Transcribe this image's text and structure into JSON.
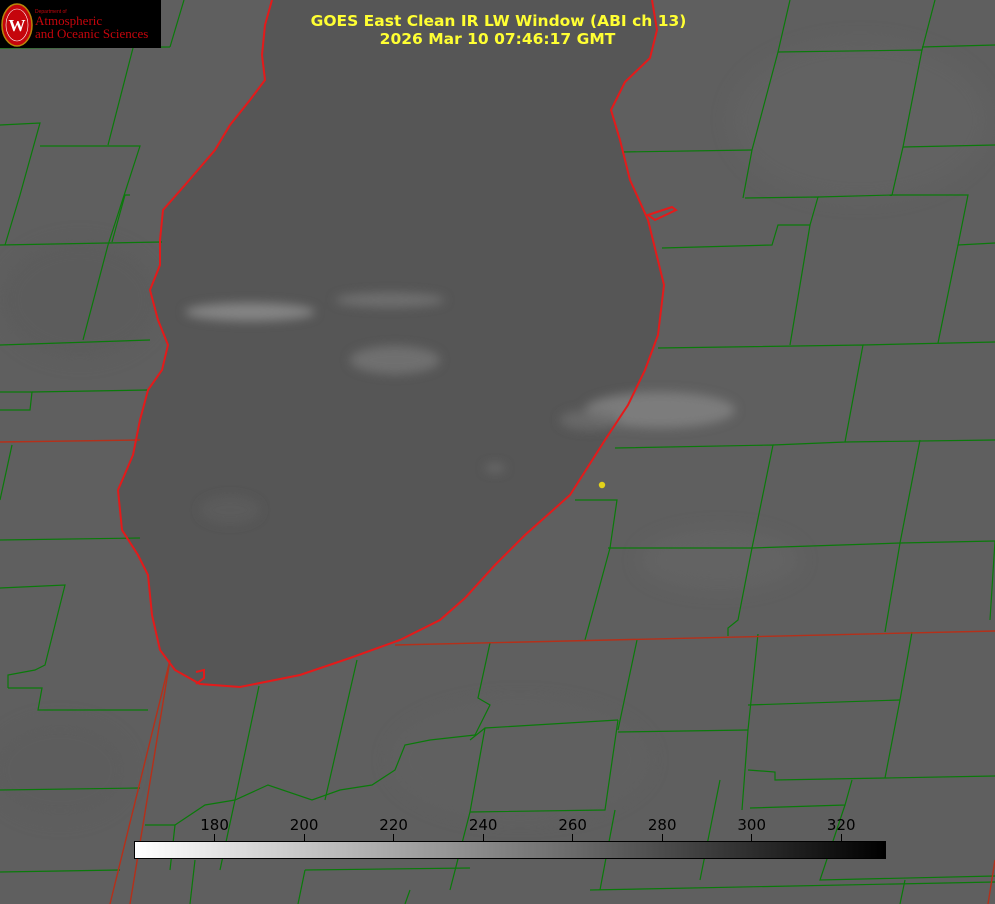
{
  "header": {
    "title_line1": "GOES East Clean IR LW Window (ABI ch 13)",
    "title_line2": "2026 Mar 10 07:46:17 GMT",
    "title_color": "#ffff33"
  },
  "logo": {
    "seal_letter": "W",
    "department": "Department of",
    "line1": "Atmospheric",
    "line2": "and Oceanic Sciences",
    "brand_color": "#c5050c"
  },
  "colorbar": {
    "ticks": [
      "180",
      "200",
      "220",
      "240",
      "260",
      "280",
      "300",
      "320"
    ],
    "tick_values": [
      180,
      200,
      220,
      240,
      260,
      280,
      300,
      320
    ],
    "range": [
      162,
      330
    ],
    "unit": "",
    "gradient_from": "#ffffff",
    "gradient_to": "#000000"
  },
  "map": {
    "background_color": "#5f5f5f",
    "lake_color": "#565656",
    "cloud_color": "#888888",
    "county_border_color": "#0a7a0a",
    "state_border_color": "#b5301a",
    "coastline_color": "#e41a1a",
    "marker_color": "#e3d21a"
  }
}
